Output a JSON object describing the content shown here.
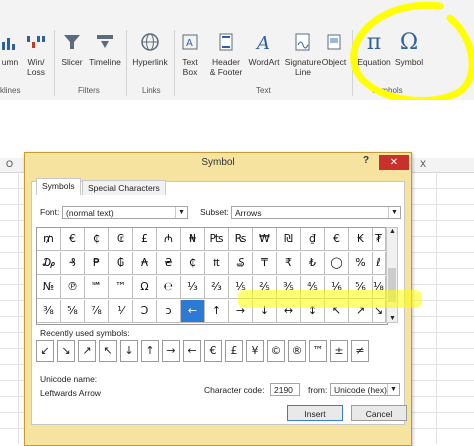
{
  "ribbon": {
    "items": [
      {
        "label": "umn",
        "icon": "column-sparkline-icon"
      },
      {
        "label": "Win/\nLoss",
        "icon": "winloss-sparkline-icon"
      },
      {
        "label": "Slicer",
        "icon": "slicer-icon"
      },
      {
        "label": "Timeline",
        "icon": "timeline-icon"
      },
      {
        "label": "Hyperlink",
        "icon": "hyperlink-icon"
      },
      {
        "label": "Text\nBox",
        "icon": "text-box-icon"
      },
      {
        "label": "Header\n& Footer",
        "icon": "header-footer-icon"
      },
      {
        "label": "WordArt",
        "icon": "wordart-icon"
      },
      {
        "label": "Signature\nLine",
        "icon": "signature-line-icon"
      },
      {
        "label": "Object",
        "icon": "object-icon"
      },
      {
        "label": "Equation",
        "icon": "pi-icon",
        "glyph": "π"
      },
      {
        "label": "Symbol",
        "icon": "omega-icon",
        "glyph": "Ω"
      }
    ],
    "groups": [
      "klines",
      "Filters",
      "Links",
      "Text",
      "Symbols"
    ]
  },
  "sheet": {
    "col_o": "O",
    "col_x": "X"
  },
  "dialog": {
    "title": "Symbol",
    "help": "?",
    "close": "✕",
    "tabs": [
      "Symbols",
      "Special Characters"
    ],
    "font_label": "Font:",
    "font_value": "(normal text)",
    "subset_label": "Subset:",
    "subset_value": "Arrows",
    "symbols": [
      [
        "₥",
        "€",
        "₵",
        "₢",
        "£",
        "₼",
        "₦",
        "₧",
        "₨",
        "₩",
        "₪",
        "₫",
        "€",
        "₭",
        "₮"
      ],
      [
        "₯",
        "₰",
        "₱",
        "₲",
        "₳",
        "₴",
        "₵",
        "₶",
        "₷",
        "₸",
        "₹",
        "₺",
        "◯",
        "%",
        "ℓ"
      ],
      [
        "№",
        "℗",
        "℠",
        "™",
        "Ω",
        "℮",
        "⅓",
        "⅔",
        "⅕",
        "⅖",
        "⅗",
        "⅘",
        "⅙",
        "⅚",
        "⅛"
      ],
      [
        "⅜",
        "⅝",
        "⅞",
        "⅟",
        "Ↄ",
        "ↄ",
        "←",
        "↑",
        "→",
        "↓",
        "↔",
        "↕",
        "↖",
        "↗",
        "↘"
      ]
    ],
    "selected_index": "3.6",
    "recent_label": "Recently used symbols:",
    "recent": [
      "↙",
      "↘",
      "↗",
      "↖",
      "↓",
      "↑",
      "→",
      "←",
      "€",
      "£",
      "¥",
      "©",
      "®",
      "™",
      "±",
      "≠"
    ],
    "unicode_name_label": "Unicode name:",
    "unicode_name": "Leftwards Arrow",
    "char_code_label": "Character code:",
    "char_code": "2190",
    "from_label": "from:",
    "from_value": "Unicode (hex)",
    "insert": "Insert",
    "cancel": "Cancel"
  }
}
